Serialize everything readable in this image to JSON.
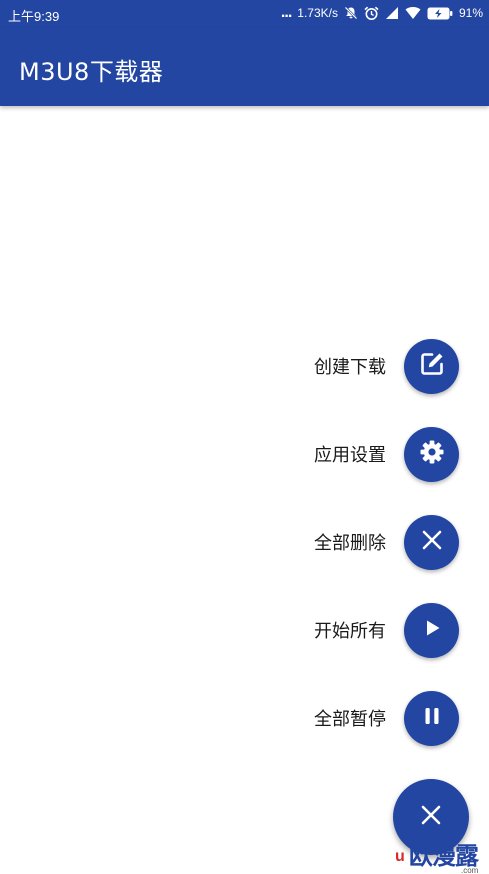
{
  "status_bar": {
    "time": "上午9:39",
    "dots": "...",
    "net_speed": "1.73K/s",
    "battery": "91%"
  },
  "app_bar": {
    "title": "M3U8下载器"
  },
  "speed_dial": {
    "items": [
      {
        "label": "创建下载",
        "icon": "edit-icon"
      },
      {
        "label": "应用设置",
        "icon": "gear-icon"
      },
      {
        "label": "全部删除",
        "icon": "close-icon"
      },
      {
        "label": "开始所有",
        "icon": "play-icon"
      },
      {
        "label": "全部暂停",
        "icon": "pause-icon"
      }
    ],
    "main_fab_icon": "close-icon"
  },
  "watermark": {
    "main": "欧漫露",
    "prefix": "u",
    "suffix": ".com"
  },
  "colors": {
    "primary": "#2346a3",
    "label_text": "#1a1a1a",
    "background": "#ffffff"
  }
}
